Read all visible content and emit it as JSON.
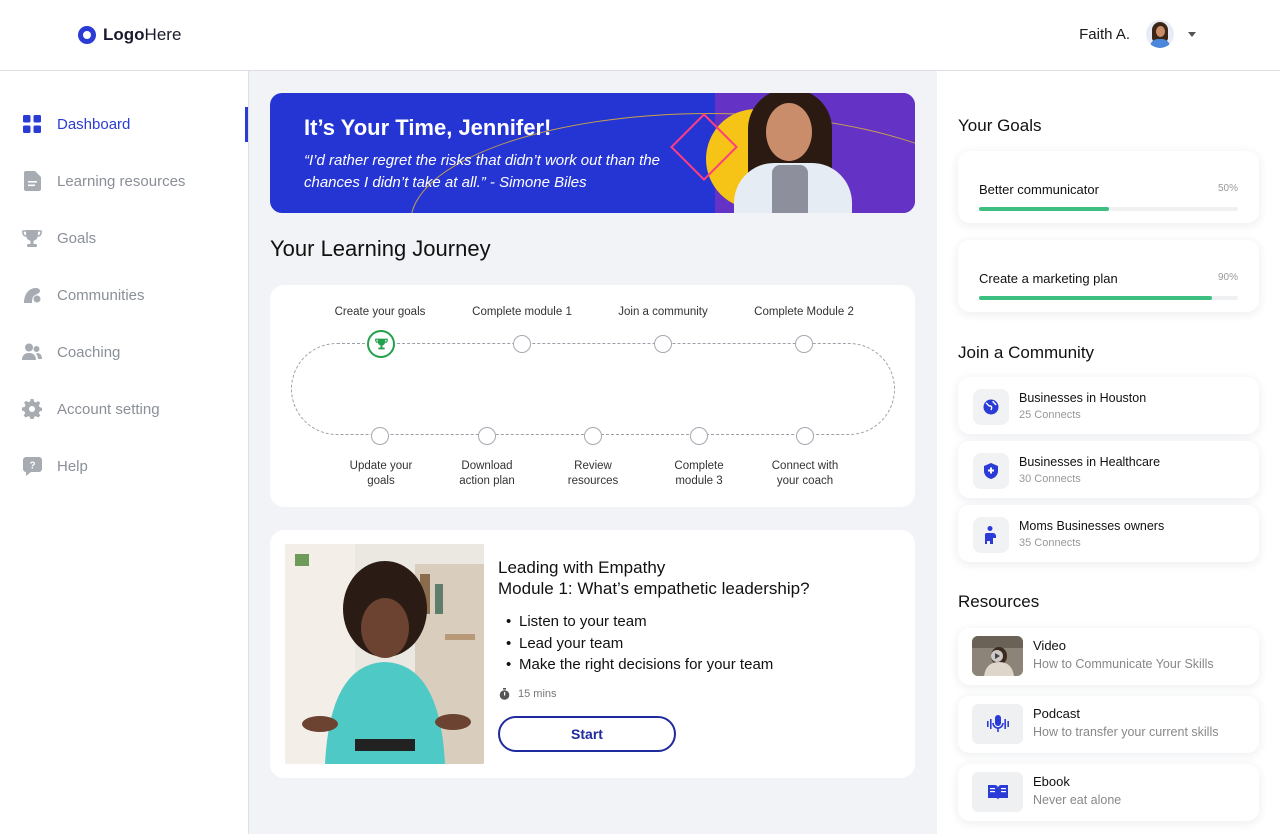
{
  "header": {
    "logo_bold": "Logo",
    "logo_regular": "Here",
    "user_name": "Faith A."
  },
  "sidebar": {
    "items": [
      {
        "label": "Dashboard",
        "icon": "grid-icon",
        "active": true
      },
      {
        "label": "Learning resources",
        "icon": "document-icon",
        "active": false
      },
      {
        "label": "Goals",
        "icon": "trophy-icon",
        "active": false
      },
      {
        "label": "Communities",
        "icon": "communities-icon",
        "active": false
      },
      {
        "label": "Coaching",
        "icon": "users-icon",
        "active": false
      },
      {
        "label": "Account setting",
        "icon": "gear-icon",
        "active": false
      },
      {
        "label": "Help",
        "icon": "help-icon",
        "active": false
      }
    ]
  },
  "banner": {
    "title": "It’s Your Time, Jennifer!",
    "quote": "“I’d rather regret the risks that didn’t work out than the chances I didn’t take at all.” - Simone Biles"
  },
  "journey": {
    "title": "Your Learning Journey",
    "top_steps": [
      "Create your goals",
      "Complete module 1",
      "Join a community",
      "Complete Module 2"
    ],
    "bottom_steps": [
      "Update your goals",
      "Download action plan",
      "Review resources",
      "Complete module 3",
      "Connect with your coach"
    ]
  },
  "module": {
    "course": "Leading with Empathy",
    "title": "Module 1: What’s empathetic leadership?",
    "bullets": [
      "Listen to your team",
      "Lead your team",
      "Make the right decisions for your team"
    ],
    "duration": "15 mins",
    "start_label": "Start"
  },
  "goals": {
    "title": "Your Goals",
    "items": [
      {
        "label": "Better communicator",
        "pct_text": "50%",
        "progress": 0.5
      },
      {
        "label": "Create a marketing plan",
        "pct_text": "90%",
        "progress": 0.9
      }
    ]
  },
  "communities": {
    "title": "Join a Community",
    "items": [
      {
        "name": "Businesses in Houston",
        "connects": "25 Connects",
        "icon": "globe-icon"
      },
      {
        "name": "Businesses in Healthcare",
        "connects": "30 Connects",
        "icon": "shield-icon"
      },
      {
        "name": "Moms Businesses owners",
        "connects": "35 Connects",
        "icon": "mom-icon"
      }
    ]
  },
  "resources": {
    "title": "Resources",
    "items": [
      {
        "type": "Video",
        "desc": "How to Communicate Your Skills",
        "icon": "video-thumbnail"
      },
      {
        "type": "Podcast",
        "desc": "How to transfer your current skills",
        "icon": "microphone-icon"
      },
      {
        "type": "Ebook",
        "desc": "Never eat alone",
        "icon": "book-icon"
      }
    ]
  },
  "colors": {
    "brand": "#2b3bd6",
    "progress": "#3cbf80",
    "done_step": "#22a04b",
    "banner_blue": "#2535d4",
    "banner_purple": "#6433c6"
  }
}
